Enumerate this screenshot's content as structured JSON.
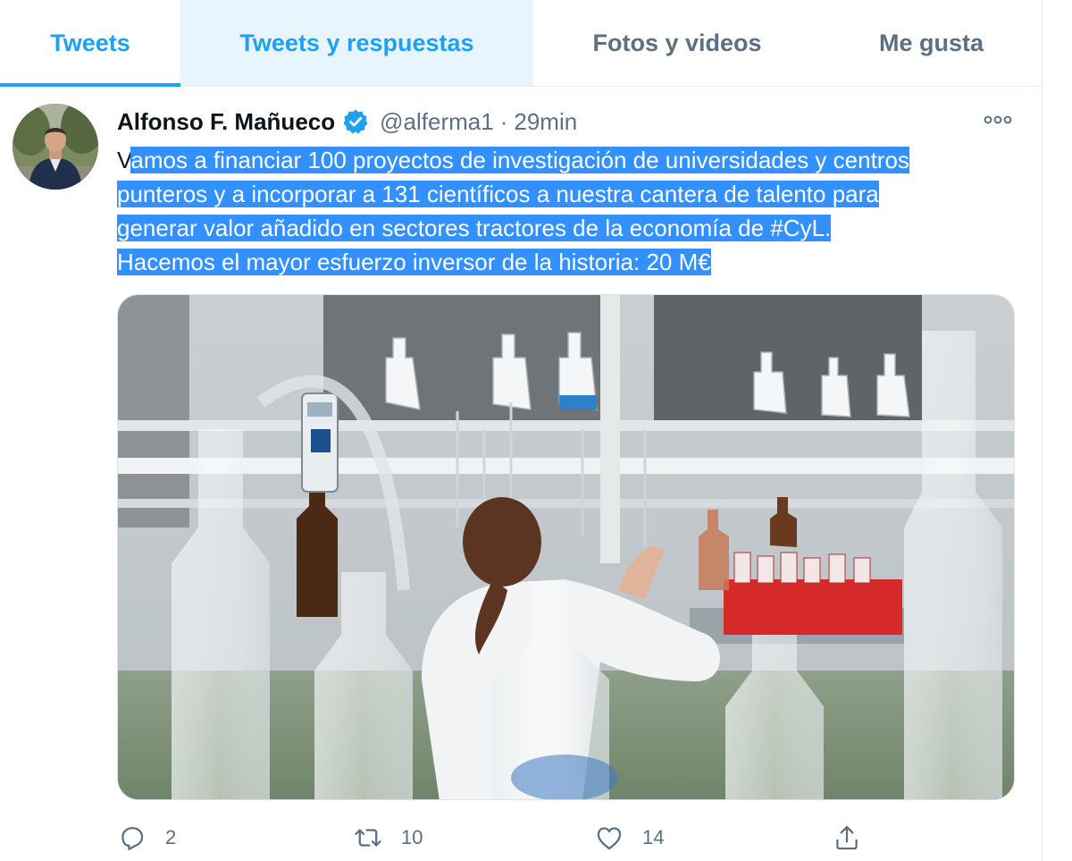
{
  "tabs": [
    {
      "label": "Tweets",
      "state": "active"
    },
    {
      "label": "Tweets y respuestas",
      "state": "hover"
    },
    {
      "label": "Fotos y videos",
      "state": "normal"
    },
    {
      "label": "Me gusta",
      "state": "normal"
    }
  ],
  "tweet": {
    "author_name": "Alfonso F. Mañueco",
    "verified": true,
    "handle": "@alferma1",
    "separator": "·",
    "time": "29min",
    "text_lines": [
      {
        "before": "V",
        "selected": "amos a financiar 100 proyectos de investigación de universidades y centros "
      },
      {
        "before": "",
        "selected": "punteros y a incorporar a 131 científicos a nuestra cantera de talento para"
      },
      {
        "before": "",
        "selected": "generar valor añadido en sectores tractores de la economía de #CyL."
      },
      {
        "before": "",
        "selected": "Hacemos el mayor esfuerzo inversor de la historia: 20 M€"
      }
    ],
    "media_icon": "laboratory-photo",
    "actions": {
      "reply_count": "2",
      "retweet_count": "10",
      "like_count": "14"
    }
  },
  "colors": {
    "accent": "#1da1f2",
    "selection": "#3390ff",
    "secondary_text": "#5b7083"
  }
}
